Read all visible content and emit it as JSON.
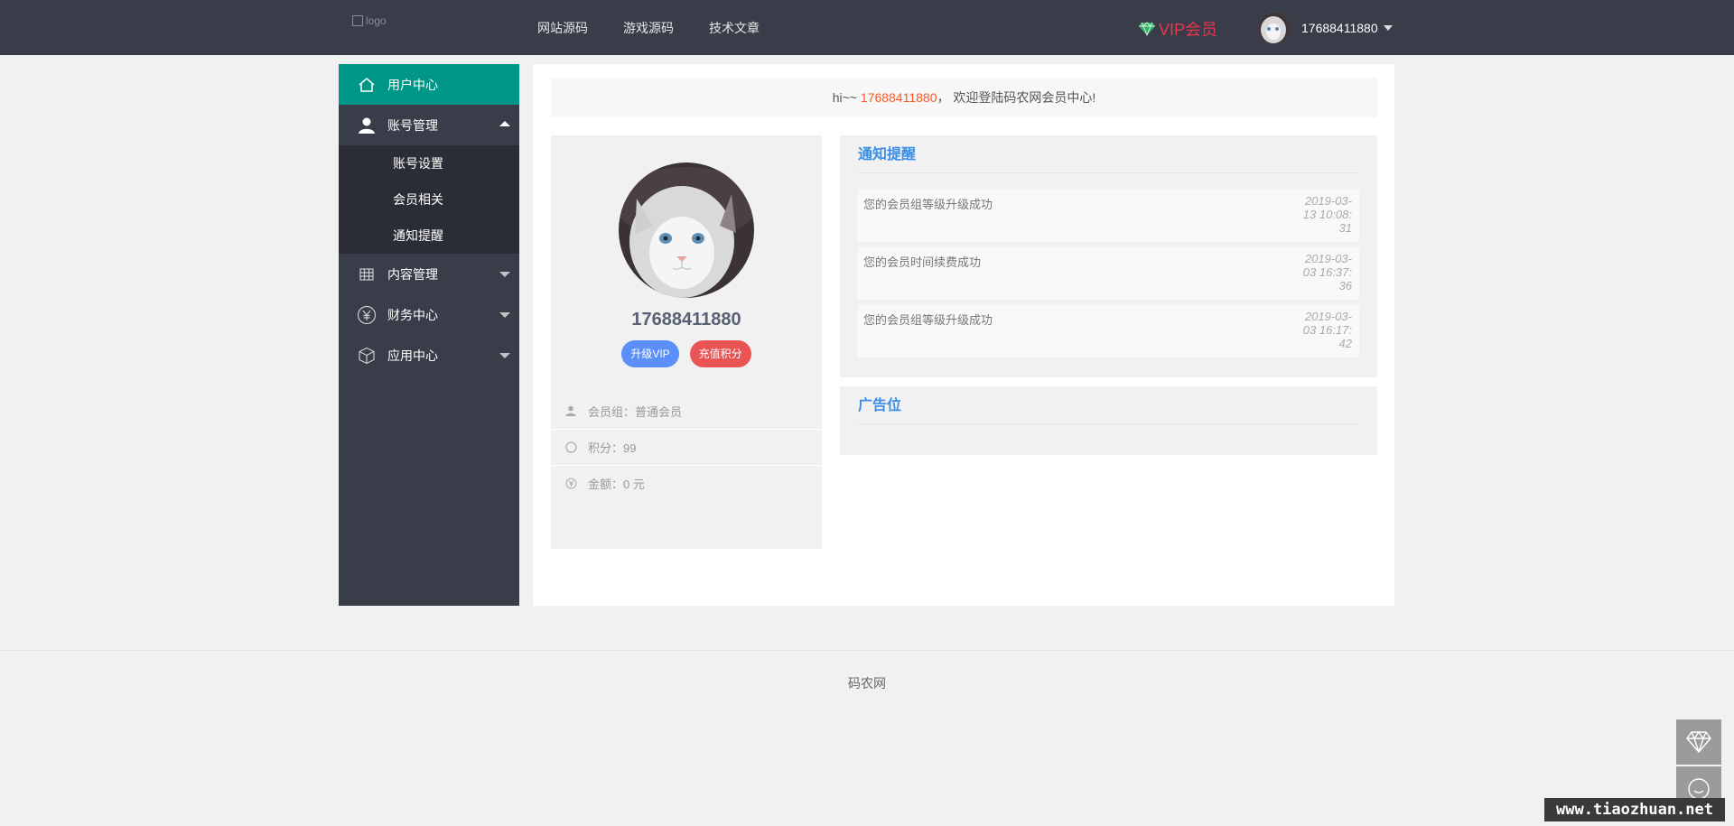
{
  "header": {
    "logo_alt": "logo",
    "nav": [
      "网站源码",
      "游戏源码",
      "技术文章"
    ],
    "vip_label": "VIP会员",
    "username": "17688411880"
  },
  "sidebar": {
    "items": [
      {
        "label": "用户中心",
        "icon": "home-icon",
        "active": true
      },
      {
        "label": "账号管理",
        "icon": "user-icon",
        "expanded": true,
        "children": [
          "账号设置",
          "会员相关",
          "通知提醒"
        ]
      },
      {
        "label": "内容管理",
        "icon": "table-icon"
      },
      {
        "label": "财务中心",
        "icon": "yen-icon"
      },
      {
        "label": "应用中心",
        "icon": "cube-icon"
      }
    ]
  },
  "greeting": {
    "prefix": "hi~~",
    "username": "17688411880",
    "suffix": "， 欢迎登陆码农网会员中心!"
  },
  "profile": {
    "name": "17688411880",
    "upgrade_button": "升级VIP",
    "recharge_button": "充值积分",
    "info": [
      {
        "icon": "user-icon",
        "text": "会员组：普通会员"
      },
      {
        "icon": "circle-icon",
        "text": "积分：99"
      },
      {
        "icon": "yen-icon",
        "text": "金额：0 元"
      }
    ]
  },
  "notices": {
    "title": "通知提醒",
    "items": [
      {
        "text": "您的会员组等级升级成功",
        "date": "2019-03-13 10:08:31"
      },
      {
        "text": "您的会员时间续费成功",
        "date": "2019-03-03 16:37:36"
      },
      {
        "text": "您的会员组等级升级成功",
        "date": "2019-03-03 16:17:42"
      }
    ]
  },
  "ad": {
    "title": "广告位"
  },
  "footer": {
    "text": "码农网"
  },
  "float_buttons": [
    "diamond-icon",
    "chat-icon"
  ],
  "watermark": "www.tiaozhuan.net",
  "colors": {
    "topbar": "#393d49",
    "active": "#009688",
    "accent_orange": "#ff5722",
    "vip_red": "#e8364f",
    "vip_green": "#2fb567"
  }
}
